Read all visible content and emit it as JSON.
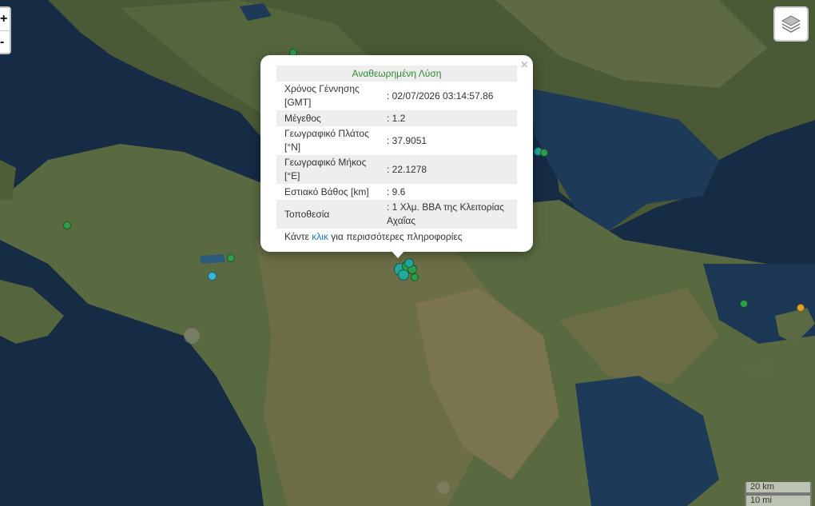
{
  "map": {
    "zoom_in_label": "+",
    "zoom_out_label": "-",
    "layers_icon": "layers-stack-icon"
  },
  "colors": {
    "marker_green": "#2e9e4a",
    "marker_teal": "#25a89a",
    "marker_cyan": "#39b7d9",
    "marker_orange": "#e0a030",
    "popup_title": "#2e8b2e",
    "link": "#1a7ab8"
  },
  "popup": {
    "title": "Αναθεωρημένη Λύση",
    "close_label": "×",
    "rows": [
      {
        "label": "Χρόνος Γέννησης [GMT]",
        "value": ": 02/07/2026 03:14:57.86"
      },
      {
        "label": "Μέγεθος",
        "value": ": 1.2"
      },
      {
        "label": "Γεωγραφικό Πλάτος [°N]",
        "value": ": 37.9051"
      },
      {
        "label": "Γεωγραφικό Μήκος [°E]",
        "value": ": 22.1278"
      },
      {
        "label": "Εστιακό Βάθος [km]",
        "value": ": 9.6"
      },
      {
        "label": "Τοποθεσία",
        "value": ": 1 Χλμ. ΒΒΑ της Κλειτορίας Αχαΐας"
      }
    ],
    "more_prefix": "Κάντε",
    "more_link": "κλικ",
    "more_suffix": "για περισσότερες πληροφορίες"
  },
  "scale": {
    "metric": "20 km",
    "imperial": "10 mi"
  }
}
